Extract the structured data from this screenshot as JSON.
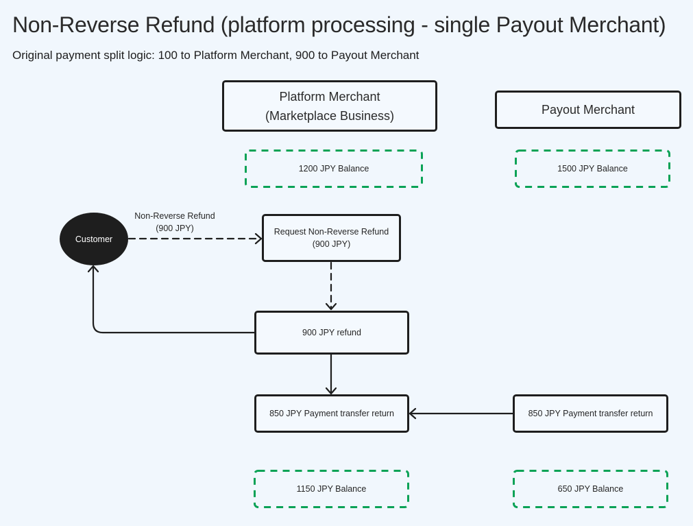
{
  "title": "Non-Reverse Refund (platform processing - single Payout Merchant)",
  "subtitle": "Original payment split logic: 100 to Platform Merchant, 900 to Payout Merchant",
  "colors": {
    "background": "#f1f7fd",
    "node_border": "#1e1e1e",
    "balance_border": "#0aa256",
    "customer_fill": "#1e1e1e"
  },
  "nodes": {
    "platform_merchant": {
      "line1": "Platform Merchant",
      "line2": "(Marketplace Business)"
    },
    "payout_merchant": {
      "label": "Payout Merchant"
    },
    "platform_balance_before": {
      "label": "1200 JPY Balance"
    },
    "payout_balance_before": {
      "label": "1500 JPY Balance"
    },
    "customer": {
      "label": "Customer"
    },
    "request_refund": {
      "line1": "Request Non-Reverse Refund",
      "line2": "(900 JPY)"
    },
    "refund": {
      "label": "900 JPY refund"
    },
    "platform_transfer_return": {
      "label": "850 JPY Payment transfer return"
    },
    "payout_transfer_return": {
      "label": "850 JPY Payment transfer return"
    },
    "platform_balance_after": {
      "label": "1150 JPY Balance"
    },
    "payout_balance_after": {
      "label": "650 JPY Balance"
    }
  },
  "edges": {
    "customer_to_request": {
      "line1": "Non-Reverse Refund",
      "line2": "(900 JPY)",
      "style": "dashed"
    },
    "request_to_refund": {
      "style": "dashed"
    },
    "refund_to_customer": {
      "style": "solid"
    },
    "refund_to_transfer_return": {
      "style": "solid"
    },
    "payout_return_to_platform_return": {
      "style": "solid"
    }
  }
}
